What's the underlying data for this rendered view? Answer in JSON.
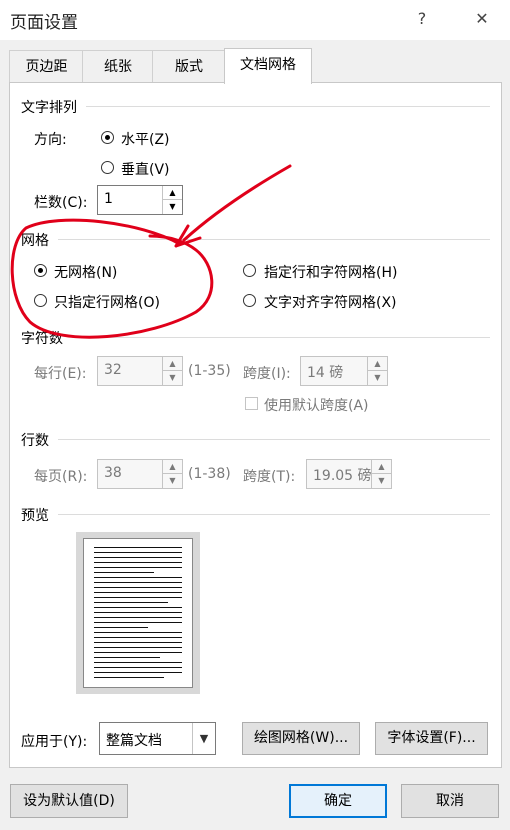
{
  "window": {
    "title": "页面设置",
    "help_icon": "?",
    "close_icon": "✕"
  },
  "tabs": [
    "页边距",
    "纸张",
    "版式",
    "文档网格"
  ],
  "active_tab": "文档网格",
  "text_direction": {
    "section_label": "文字排列",
    "direction_label": "方向:",
    "options": [
      "水平(Z)",
      "垂直(V)"
    ],
    "selected": "水平(Z)",
    "columns_label": "栏数(C):",
    "columns_value": "1"
  },
  "grid": {
    "section_label": "网格",
    "options": [
      "无网格(N)",
      "指定行和字符网格(H)",
      "只指定行网格(O)",
      "文字对齐字符网格(X)"
    ],
    "selected": "无网格(N)"
  },
  "chars": {
    "section_label": "字符数",
    "per_line_label": "每行(E):",
    "per_line_value": "32",
    "per_line_range": "(1-35)",
    "pitch_label": "跨度(I):",
    "pitch_value": "14 磅",
    "default_pitch_label": "使用默认跨度(A)"
  },
  "lines": {
    "section_label": "行数",
    "per_page_label": "每页(R):",
    "per_page_value": "38",
    "per_page_range": "(1-38)",
    "pitch_label": "跨度(T):",
    "pitch_value": "19.05 磅"
  },
  "preview": {
    "section_label": "预览"
  },
  "apply": {
    "label": "应用于(Y):",
    "value": "整篇文档",
    "draw_grid_button": "绘图网格(W)...",
    "font_settings_button": "字体设置(F)..."
  },
  "footer": {
    "set_default_button": "设为默认值(D)",
    "ok_button": "确定",
    "cancel_button": "取消"
  },
  "colors": {
    "annotation": "#e0001a",
    "accent": "#0078d7"
  }
}
